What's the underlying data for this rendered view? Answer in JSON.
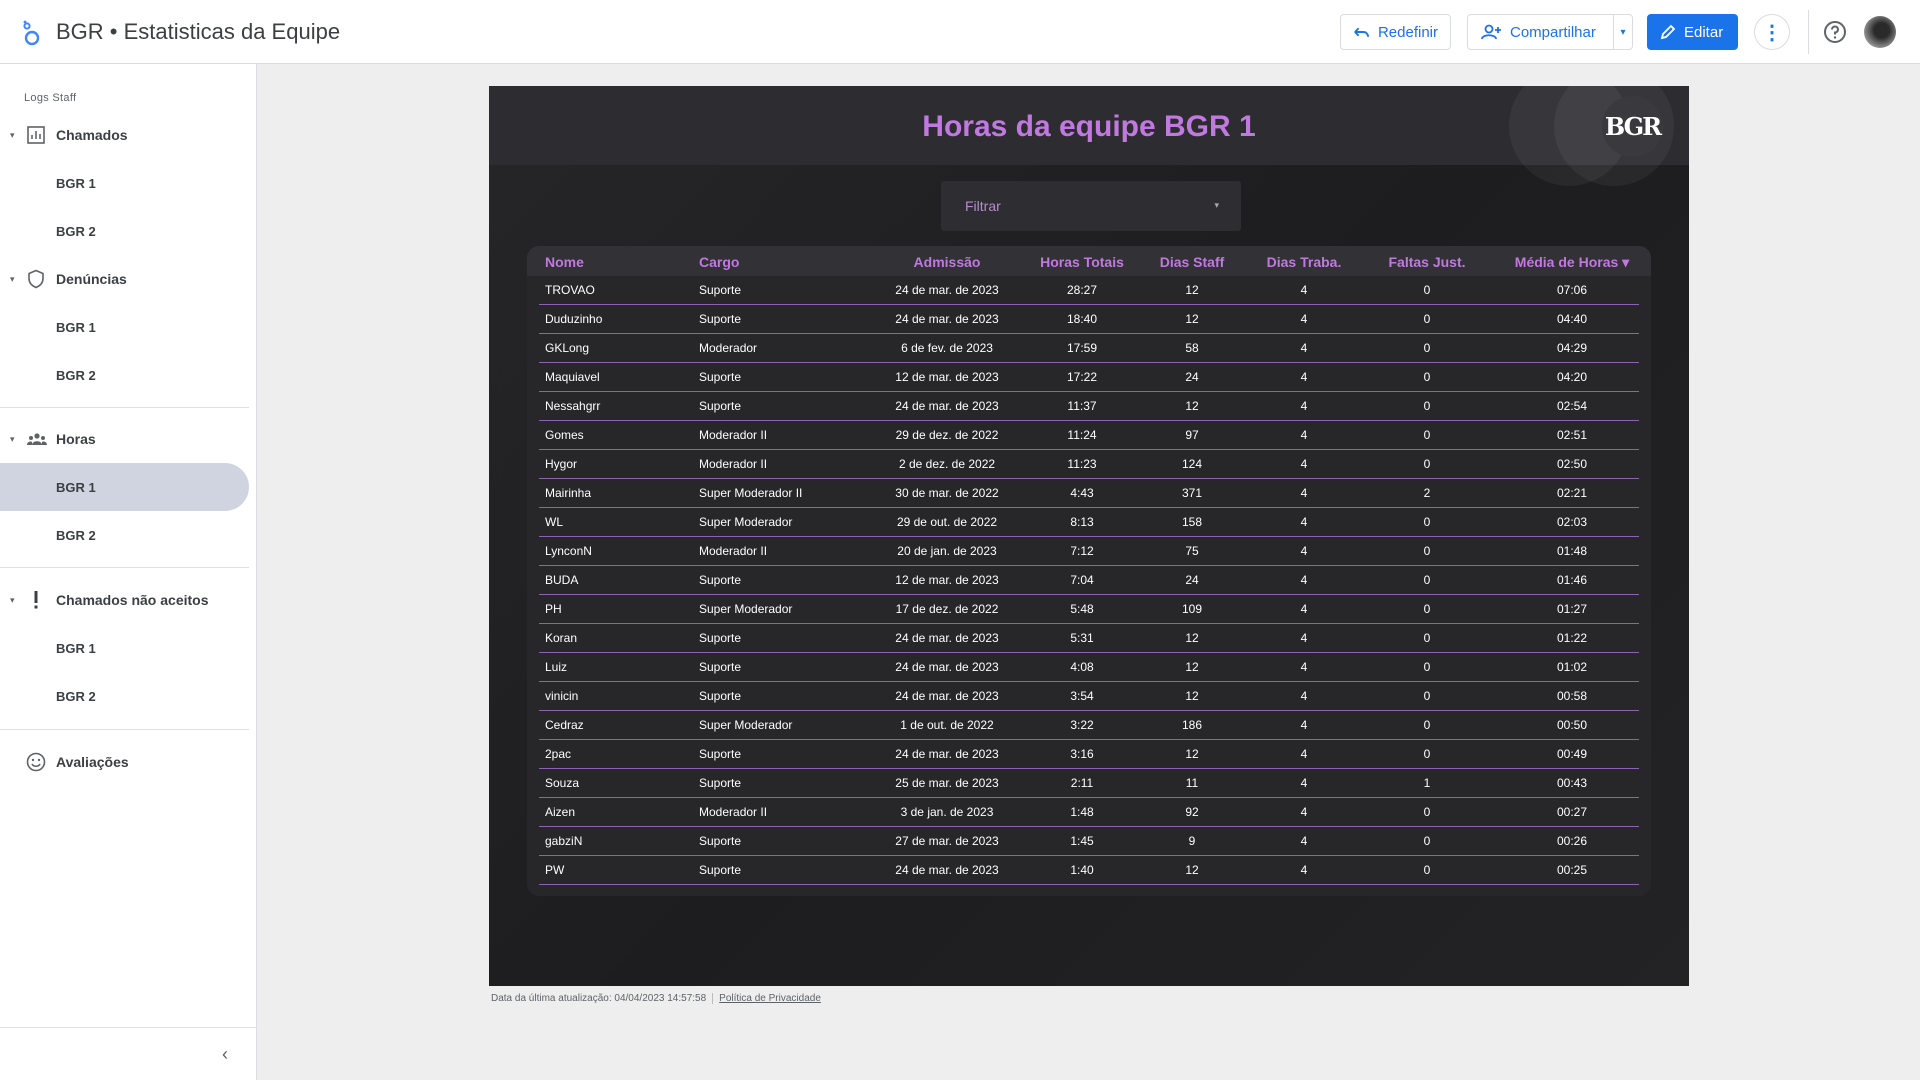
{
  "app": {
    "title": "BGR • Estatisticas da Equipe"
  },
  "toolbar": {
    "reset_label": "Redefinir",
    "share_label": "Compartilhar",
    "edit_label": "Editar",
    "more_glyph": "⋮",
    "caret_glyph": "▾"
  },
  "sidebar": {
    "section_label": "Logs Staff",
    "groups": [
      {
        "label": "Chamados",
        "icon": "bar-chart-icon",
        "items": [
          "BGR 1",
          "BGR 2"
        ]
      },
      {
        "label": "Denúncias",
        "icon": "shield-icon",
        "items": [
          "BGR 1",
          "BGR 2"
        ]
      },
      {
        "label": "Horas",
        "icon": "group-icon",
        "items": [
          "BGR 1",
          "BGR 2"
        ],
        "active_item": 0
      },
      {
        "label": "Chamados não aceitos",
        "icon": "exclamation-icon",
        "items": [
          "BGR 1",
          "BGR 2"
        ]
      },
      {
        "label": "Avaliações",
        "icon": "smiley-icon",
        "items": []
      }
    ],
    "collapse_glyph": "‹"
  },
  "report": {
    "title": "Horas da equipe BGR 1",
    "brand_text": "BGR",
    "filter_placeholder": "Filtrar",
    "filter_caret": "▾",
    "columns": [
      "Nome",
      "Cargo",
      "Admissão",
      "Horas Totais",
      "Dias Staff",
      "Dias Traba.",
      "Faltas Just.",
      "Média de Horas ▾"
    ],
    "rows": [
      [
        "TROVAO",
        "Suporte",
        "24 de mar. de 2023",
        "28:27",
        "12",
        "4",
        "0",
        "07:06"
      ],
      [
        "Duduzinho",
        "Suporte",
        "24 de mar. de 2023",
        "18:40",
        "12",
        "4",
        "0",
        "04:40"
      ],
      [
        "GKLong",
        "Moderador",
        "6 de fev. de 2023",
        "17:59",
        "58",
        "4",
        "0",
        "04:29"
      ],
      [
        "Maquiavel",
        "Suporte",
        "12 de mar. de 2023",
        "17:22",
        "24",
        "4",
        "0",
        "04:20"
      ],
      [
        "Nessahgrr",
        "Suporte",
        "24 de mar. de 2023",
        "11:37",
        "12",
        "4",
        "0",
        "02:54"
      ],
      [
        "Gomes",
        "Moderador II",
        "29 de dez. de 2022",
        "11:24",
        "97",
        "4",
        "0",
        "02:51"
      ],
      [
        "Hygor",
        "Moderador II",
        "2 de dez. de 2022",
        "11:23",
        "124",
        "4",
        "0",
        "02:50"
      ],
      [
        "Mairinha",
        "Super Moderador II",
        "30 de mar. de 2022",
        "4:43",
        "371",
        "4",
        "2",
        "02:21"
      ],
      [
        "WL",
        "Super Moderador",
        "29 de out. de 2022",
        "8:13",
        "158",
        "4",
        "0",
        "02:03"
      ],
      [
        "LynconN",
        "Moderador II",
        "20 de jan. de 2023",
        "7:12",
        "75",
        "4",
        "0",
        "01:48"
      ],
      [
        "BUDA",
        "Suporte",
        "12 de mar. de 2023",
        "7:04",
        "24",
        "4",
        "0",
        "01:46"
      ],
      [
        "PH",
        "Super Moderador",
        "17 de dez. de 2022",
        "5:48",
        "109",
        "4",
        "0",
        "01:27"
      ],
      [
        "Koran",
        "Suporte",
        "24 de mar. de 2023",
        "5:31",
        "12",
        "4",
        "0",
        "01:22"
      ],
      [
        "Luiz",
        "Suporte",
        "24 de mar. de 2023",
        "4:08",
        "12",
        "4",
        "0",
        "01:02"
      ],
      [
        "vinicin",
        "Suporte",
        "24 de mar. de 2023",
        "3:54",
        "12",
        "4",
        "0",
        "00:58"
      ],
      [
        "Cedraz",
        "Super Moderador",
        "1 de out. de 2022",
        "3:22",
        "186",
        "4",
        "0",
        "00:50"
      ],
      [
        "2pac",
        "Suporte",
        "24 de mar. de 2023",
        "3:16",
        "12",
        "4",
        "0",
        "00:49"
      ],
      [
        "Souza",
        "Suporte",
        "25 de mar. de 2023",
        "2:11",
        "11",
        "4",
        "1",
        "00:43"
      ],
      [
        "Aizen",
        "Moderador II",
        "3 de jan. de 2023",
        "1:48",
        "92",
        "4",
        "0",
        "00:27"
      ],
      [
        "gabziN",
        "Suporte",
        "27 de mar. de 2023",
        "1:45",
        "9",
        "4",
        "0",
        "00:26"
      ],
      [
        "PW",
        "Suporte",
        "24 de mar. de 2023",
        "1:40",
        "12",
        "4",
        "0",
        "00:25"
      ]
    ]
  },
  "footer": {
    "updated_text": "Data da última atualização: 04/04/2023 14:57:58",
    "privacy_link": "Política de Privacidade"
  },
  "colors": {
    "accent": "#1a73e8",
    "report_title": "#c179e0",
    "row_border": "#8c63b0",
    "active_item_bg": "#cfd4e0"
  }
}
